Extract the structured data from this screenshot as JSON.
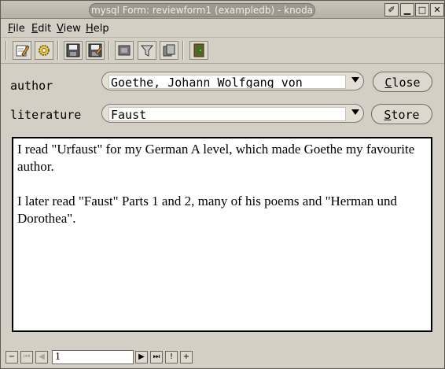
{
  "window": {
    "title": "mysql Form: reviewform1 (exampledb) - knoda",
    "controls": [
      "pin",
      "minimize",
      "maximize",
      "close"
    ]
  },
  "menu": {
    "items": [
      {
        "label": "File",
        "mnemonic": "F",
        "rest": "ile"
      },
      {
        "label": "Edit",
        "mnemonic": "E",
        "rest": "dit"
      },
      {
        "label": "View",
        "mnemonic": "V",
        "rest": "iew"
      },
      {
        "label": "Help",
        "mnemonic": "H",
        "rest": "elp"
      }
    ]
  },
  "toolbar": {
    "icons": [
      "design-mode-icon",
      "view-mode-icon",
      "save-icon",
      "save-as-icon",
      "print-icon",
      "filter-icon",
      "sort-icon",
      "exit-icon"
    ]
  },
  "form": {
    "author_label": "author",
    "author_value": "Goethe, Johann Wolfgang von",
    "literature_label": "literature",
    "literature_value": "Faust",
    "close_button": {
      "mnemonic": "C",
      "rest": "lose"
    },
    "store_button": {
      "mnemonic": "S",
      "rest": "tore"
    },
    "review_text": "I read \"Urfaust\" for my German A level, which made Goethe my favourite author.\n\nI later read \"Faust\" Parts 1 and 2, many of his poems and \"Herman und Dorothea\"."
  },
  "navigation": {
    "record_number": "1",
    "buttons": [
      "minus",
      "first",
      "previous",
      "next",
      "last",
      "exclamation",
      "plus"
    ],
    "glyphs": {
      "minus": "−",
      "first": "⏮",
      "previous": "◀",
      "next": "▶",
      "last": "⏭",
      "exclamation": "!",
      "plus": "+"
    }
  },
  "colors": {
    "background": "#d4cfc4",
    "titlebar_pill": "#9e998f",
    "text_area": "#ffffff"
  }
}
